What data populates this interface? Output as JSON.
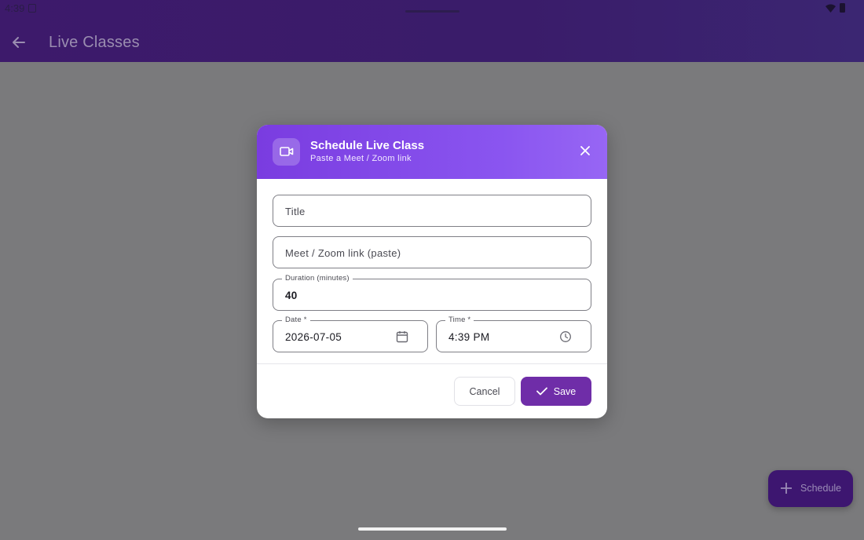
{
  "status_bar": {
    "time": "4:39"
  },
  "app_bar": {
    "title": "Live Classes"
  },
  "dialog": {
    "title": "Schedule Live Class",
    "subtitle": "Paste a Meet / Zoom link",
    "fields": {
      "title_placeholder": "Title",
      "link_placeholder": "Meet / Zoom link (paste)",
      "duration_label": "Duration (minutes)",
      "duration_value": "40",
      "date_label": "Date *",
      "date_value": "2026-07-05",
      "time_label": "Time *",
      "time_value": "4:39 PM"
    },
    "buttons": {
      "cancel": "Cancel",
      "save": "Save"
    }
  },
  "fab": {
    "label": "Schedule"
  },
  "colors": {
    "header_gradient_start": "#7a3ce0",
    "header_gradient_end": "#9766f4",
    "save_button": "#6f2da8",
    "scrim": "#7a7a7c"
  },
  "icons": {
    "back": "arrow-left-icon",
    "header": "video-camera-icon",
    "close": "close-icon",
    "date": "calendar-icon",
    "time": "clock-icon",
    "save": "check-icon",
    "fab": "plus-icon"
  }
}
